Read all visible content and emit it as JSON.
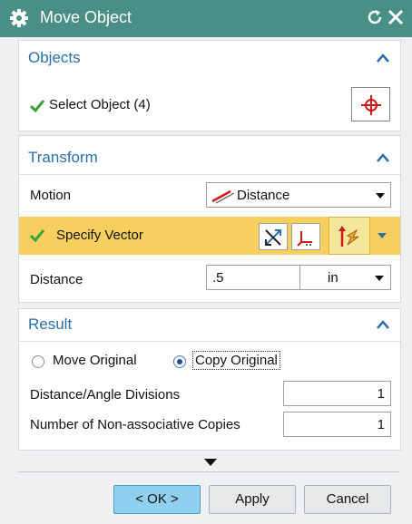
{
  "window": {
    "title": "Move Object"
  },
  "objects": {
    "header": "Objects",
    "select_label": "Select Object (4)"
  },
  "transform": {
    "header": "Transform",
    "motion_label": "Motion",
    "motion_value": "Distance",
    "vector_label": "Specify Vector",
    "distance_label": "Distance",
    "distance_value": ".5",
    "distance_unit": "in"
  },
  "result": {
    "header": "Result",
    "move_original_label": "Move Original",
    "copy_original_label": "Copy Original",
    "selected_option": "Copy Original",
    "divisions_label": "Distance/Angle Divisions",
    "divisions_value": "1",
    "copies_label": "Number of Non-associative Copies",
    "copies_value": "1"
  },
  "footer": {
    "ok_label": "< OK >",
    "apply_label": "Apply",
    "cancel_label": "Cancel"
  },
  "colors": {
    "title_bar": "#4a8f85",
    "section_header": "#2a6fa8",
    "check_green": "#37a33a",
    "vector_highlight": "#f7cf5e",
    "ok_button": "#8fd0f0"
  },
  "icons": [
    "settings-gear-icon",
    "reset-icon",
    "close-icon",
    "chevron-up-icon",
    "crosshair-icon",
    "distance-motion-icon",
    "vector-dialog-icon",
    "csys-axis-icon",
    "inferred-vector-icon",
    "dropdown-arrow-icon",
    "expand-more-icon",
    "checkmark-icon"
  ]
}
